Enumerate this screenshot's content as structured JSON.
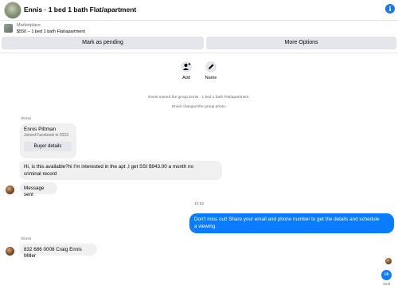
{
  "header": {
    "title": "Ennis · 1 bed 1 bath Flat/apartment",
    "info_icon": "info-icon"
  },
  "marketplace": {
    "source": "Marketplace",
    "listing": "$550 – 1 bed 1 bath Flat/apartment",
    "mark_pending_label": "Mark as pending",
    "more_options_label": "More Options"
  },
  "actions": {
    "add_label": "Add",
    "name_label": "Name"
  },
  "system_messages": [
    "Ennis named the group Ennis · 1 bed 1 bath Flat/apartment.",
    "Ennis changed the group photo."
  ],
  "incoming": {
    "sender": "Ennis",
    "card_name": "Ennis Pittman",
    "card_sub": "Joined Facebook in 2023",
    "buyer_details_label": "Buyer details",
    "msg1_line1": "Hi, is this available?hi I'm interested in the apt ,I get SSI  $943.00 a month  no",
    "msg1_line2": "criminal record",
    "msg2": "Message sent"
  },
  "timestamp": "12:52",
  "outgoing": {
    "line1": "Don't miss out! Share your email and phone number to get the details and schedule",
    "line2": "a viewing."
  },
  "incoming2": {
    "sender": "Ennis",
    "msg": "832 686 0008 Craig Ennis Miller"
  },
  "last_outgoing": {
    "msg": "ok",
    "status": "Sent"
  },
  "colors": {
    "accent": "#0a7cff",
    "bubble_in": "#f0f0f0",
    "button_bg": "#e4e6eb"
  }
}
